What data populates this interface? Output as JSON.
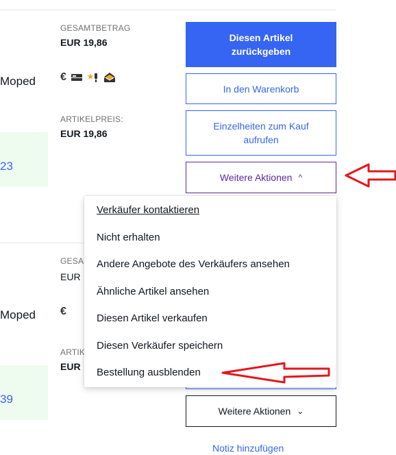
{
  "order1": {
    "total_label": "GESAMTBETRAG",
    "total_value": "EUR 19,86",
    "item_price_label": "ARTIKELPREIS:",
    "item_price_value": "EUR 19,86",
    "title_fragment": "Moped",
    "status_fragment": "23",
    "buttons": {
      "return": "Diesen Artikel zurückgeben",
      "cart": "In den Warenkorb",
      "details": "Einzelheiten zum Kauf aufrufen",
      "more": "Weitere Aktionen"
    },
    "icons": [
      "euro-icon",
      "delivery-truck-icon",
      "star-feedback-icon",
      "mail-icon"
    ]
  },
  "dropdown": {
    "items": [
      "Verkäufer kontaktieren",
      "Nicht erhalten",
      "Andere Angebote des Verkäufers ansehen",
      "Ähnliche Artikel ansehen",
      "Diesen Artikel verkaufen",
      "Diesen Verkäufer speichern",
      "Bestellung ausblenden"
    ]
  },
  "order2": {
    "total_label_fragment": "GESA",
    "total_value_fragment": "EUR",
    "item_price_label_fragment": "ARTIK",
    "item_price_value_fragment": "EUR",
    "title_fragment": "Moped",
    "status_fragment": "39",
    "buttons": {
      "more": "Weitere Aktionen",
      "note": "Notiz hinzufügen"
    }
  },
  "annotation_color": "#e3161d",
  "accent_color": "#3665f3"
}
